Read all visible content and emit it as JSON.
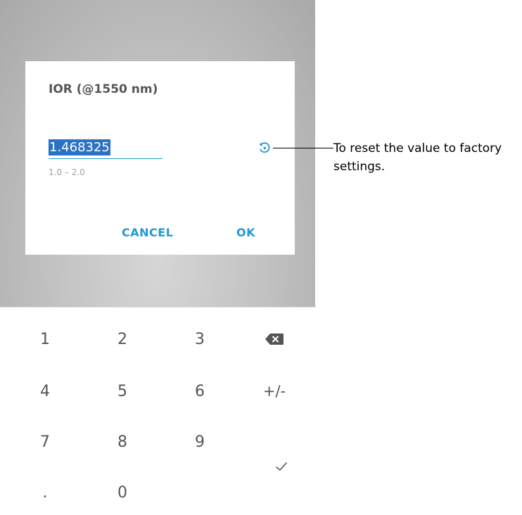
{
  "dialog": {
    "title": "IOR (@1550 nm)",
    "value": "1.468325",
    "range_hint": "1.0 – 2.0",
    "cancel_label": "CANCEL",
    "ok_label": "OK",
    "reset_icon": "reset-icon",
    "accent_color": "#1f9ad6",
    "selection_color": "#2a72c6"
  },
  "keypad": {
    "keys": [
      "1",
      "2",
      "3",
      "4",
      "5",
      "6",
      "+/-",
      "7",
      "8",
      "9",
      ".",
      "0"
    ],
    "backspace_icon": "backspace-icon",
    "confirm_icon": "checkmark-icon"
  },
  "callout": {
    "text": "To reset the value to factory settings."
  }
}
